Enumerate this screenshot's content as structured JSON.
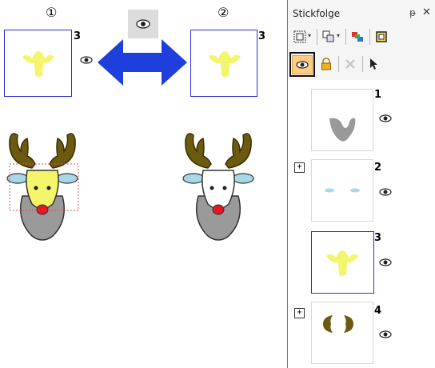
{
  "left_area": {
    "label_1": "①",
    "label_2": "②",
    "thumb_1_number": "3",
    "thumb_2_number": "3"
  },
  "panel": {
    "title": "Stickfolge",
    "pin_glyph": "ᵽ",
    "close_glyph": "✕",
    "items": [
      {
        "number": "1",
        "has_expander": false,
        "selected": false
      },
      {
        "number": "2",
        "has_expander": true,
        "selected": false
      },
      {
        "number": "3",
        "has_expander": false,
        "selected": true
      },
      {
        "number": "4",
        "has_expander": true,
        "selected": false
      }
    ],
    "expander_glyph": "+"
  },
  "colors": {
    "accent_blue": "#1f3fdc",
    "selection_border": "#2b2bd9",
    "eye_button_bg": "#ffcc80",
    "yellow_part": "#f3f56a"
  },
  "icons": [
    "eye-icon",
    "double-arrow-icon",
    "fit-view-icon",
    "group-icon",
    "color-sort-icon",
    "frame-icon",
    "lock-icon",
    "delete-icon",
    "pointer-icon",
    "pin-icon",
    "close-icon"
  ]
}
